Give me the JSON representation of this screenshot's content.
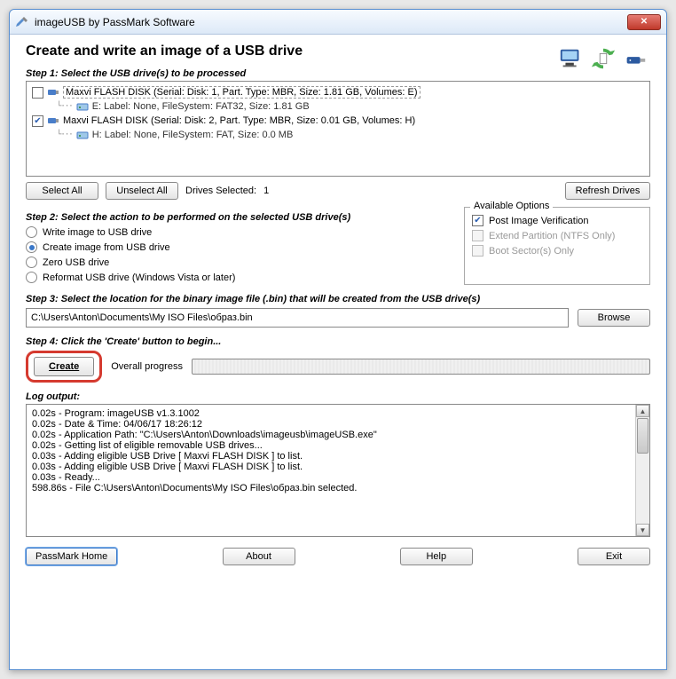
{
  "window": {
    "title": "imageUSB by PassMark Software"
  },
  "main_title": "Create and write an image of a USB drive",
  "step1": {
    "label": "Step 1:  Select the USB drive(s) to be processed",
    "drives": [
      {
        "checked": false,
        "label": "Maxvi FLASH DISK (Serial:  Disk: 1, Part. Type: MBR, Size: 1.81 GB, Volumes: E)",
        "child": "E: Label: None, FileSystem: FAT32, Size: 1.81 GB"
      },
      {
        "checked": true,
        "label": "Maxvi FLASH DISK (Serial:  Disk: 2, Part. Type: MBR, Size: 0.01 GB, Volumes: H)",
        "child": "H: Label: None, FileSystem: FAT, Size: 0.0 MB"
      }
    ],
    "select_all": "Select All",
    "unselect_all": "Unselect All",
    "drives_selected_label": "Drives Selected:",
    "drives_selected_count": "1",
    "refresh": "Refresh Drives"
  },
  "step2": {
    "label": "Step 2: Select the action to be performed on the selected USB drive(s)",
    "options": [
      {
        "text": "Write image to USB drive",
        "selected": false
      },
      {
        "text": "Create image from USB drive",
        "selected": true
      },
      {
        "text": "Zero USB drive",
        "selected": false
      },
      {
        "text": "Reformat USB drive (Windows Vista or later)",
        "selected": false
      }
    ],
    "available": {
      "legend": "Available Options",
      "opts": [
        {
          "text": "Post Image Verification",
          "checked": true,
          "disabled": false
        },
        {
          "text": "Extend Partition (NTFS Only)",
          "checked": false,
          "disabled": true
        },
        {
          "text": "Boot Sector(s) Only",
          "checked": false,
          "disabled": true
        }
      ]
    }
  },
  "step3": {
    "label": "Step 3: Select the location for the binary image file (.bin) that will be created from the USB drive(s)",
    "path": "C:\\Users\\Anton\\Documents\\My ISO Files\\образ.bin",
    "browse": "Browse"
  },
  "step4": {
    "label": "Step 4: Click the 'Create' button to begin...",
    "create": "Create",
    "progress_label": "Overall progress"
  },
  "log": {
    "label": "Log output:",
    "lines": [
      "0.02s - Program: imageUSB v1.3.1002",
      "0.02s - Date & Time: 04/06/17 18:26:12",
      "0.02s - Application Path: \"C:\\Users\\Anton\\Downloads\\imageusb\\imageUSB.exe\"",
      "0.02s - Getting list of eligible removable USB drives...",
      "0.03s -    Adding eligible USB Drive [   Maxvi FLASH DISK    ] to list.",
      "0.03s -    Adding eligible USB Drive [   Maxvi FLASH DISK    ] to list.",
      "0.03s - Ready...",
      "598.86s - File C:\\Users\\Anton\\Documents\\My ISO Files\\образ.bin selected."
    ]
  },
  "footer": {
    "passmark": "PassMark Home",
    "about": "About",
    "help": "Help",
    "exit": "Exit"
  }
}
